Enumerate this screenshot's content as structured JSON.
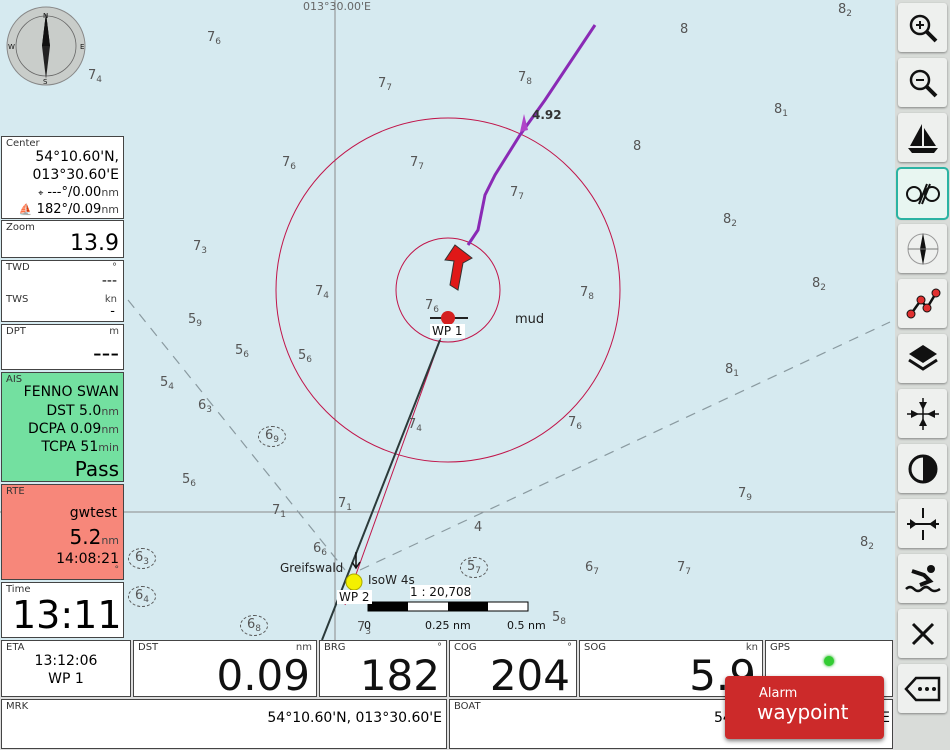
{
  "chart": {
    "top_coordinate": "013°30.00'E",
    "depths": [
      {
        "d": "7",
        "s": "6"
      },
      {
        "d": "7",
        "s": "4"
      },
      {
        "d": "7",
        "s": "7"
      },
      {
        "d": "7",
        "s": "8"
      },
      {
        "d": "8",
        "s": ""
      },
      {
        "d": "8",
        "s": "2"
      },
      {
        "d": "8",
        "s": "1"
      },
      {
        "d": "8",
        "s": ""
      },
      {
        "d": "7",
        "s": "6"
      },
      {
        "d": "7",
        "s": "7"
      },
      {
        "d": "7",
        "s": "7"
      },
      {
        "d": "8",
        "s": "2"
      },
      {
        "d": "7",
        "s": "3"
      },
      {
        "d": "7",
        "s": "4"
      },
      {
        "d": "7",
        "s": "6"
      },
      {
        "d": "7",
        "s": "8"
      },
      {
        "d": "8",
        "s": "2"
      },
      {
        "d": "5",
        "s": "9"
      },
      {
        "d": "5",
        "s": "6"
      },
      {
        "d": "5",
        "s": "6"
      },
      {
        "d": "5",
        "s": "4"
      },
      {
        "d": "6",
        "s": "3"
      },
      {
        "d": "8",
        "s": "1"
      },
      {
        "d": "7",
        "s": "4"
      },
      {
        "d": "7",
        "s": "6"
      },
      {
        "d": "5",
        "s": "6"
      },
      {
        "d": "7",
        "s": "1"
      },
      {
        "d": "7",
        "s": "1"
      },
      {
        "d": "7",
        "s": "9"
      },
      {
        "d": "6",
        "s": "6"
      },
      {
        "d": "6",
        "s": "7"
      },
      {
        "d": "7",
        "s": "7"
      },
      {
        "d": "8",
        "s": "2"
      },
      {
        "d": "7",
        "s": "3"
      },
      {
        "d": "5",
        "s": "8"
      },
      {
        "d": "4",
        "s": ""
      }
    ],
    "rocks": [
      {
        "d": "6",
        "s": "9"
      },
      {
        "d": "6",
        "s": "3"
      },
      {
        "d": "6",
        "s": "4"
      },
      {
        "d": "6",
        "s": "8"
      },
      {
        "d": "5",
        "s": "7"
      }
    ],
    "speed_label": "4.92",
    "mud_label": "mud",
    "wp1_label": "WP 1",
    "wp2_label": "WP 2",
    "greifswald_label": "Greifswald",
    "light_label": "IsoW 4s",
    "scale": {
      "ratio": "1 : 20,708",
      "t0": "0",
      "t1": "0.25 nm",
      "t2": "0.5 nm"
    }
  },
  "left": {
    "center": {
      "label": "Center",
      "lat": "54°10.60'N,",
      "lon": "013°30.60'E",
      "wp": "---°/0.00",
      "wp_unit": "nm",
      "boat": "182°/0.09",
      "boat_unit": "nm"
    },
    "zoom": {
      "label": "Zoom",
      "value": "13.9"
    },
    "wind": {
      "twd_label": "TWD",
      "twd_unit": "°",
      "twd_value": "---",
      "tws_label": "TWS",
      "tws_unit": "kn",
      "tws_value": "-"
    },
    "dpt": {
      "label": "DPT",
      "unit": "m",
      "value": "---"
    },
    "ais": {
      "label": "AIS",
      "name": "FENNO SWAN",
      "dst_label": "DST",
      "dst": "5.0",
      "dst_unit": "nm",
      "dcpa_label": "DCPA",
      "dcpa": "0.09",
      "dcpa_unit": "nm",
      "tcpa_label": "TCPA",
      "tcpa": "51",
      "tcpa_unit": "min",
      "status": "Pass"
    },
    "rte": {
      "label": "RTE",
      "name": "gwtest",
      "dist": "5.2",
      "dist_unit": "nm",
      "eta": "14:08:21",
      "deg": "°"
    },
    "time": {
      "label": "Time",
      "value": "13:11"
    }
  },
  "bottom": {
    "eta": {
      "label": "ETA",
      "time": "13:12:06",
      "wp": "WP 1"
    },
    "dst": {
      "label": "DST",
      "unit": "nm",
      "value": "0.09"
    },
    "brg": {
      "label": "BRG",
      "unit": "°",
      "value": "182"
    },
    "cog": {
      "label": "COG",
      "unit": "°",
      "value": "204"
    },
    "sog": {
      "label": "SOG",
      "unit": "kn",
      "value": "5.9"
    },
    "gps": {
      "label": "GPS"
    },
    "mrk": {
      "label": "MRK",
      "value": "54°10.60'N, 013°30.60'E"
    },
    "boat": {
      "label": "BOAT",
      "value": "54°10.5",
      "value_end": "E"
    }
  },
  "alarm": {
    "title": "Alarm",
    "text": "waypoint"
  },
  "toolbar": [
    "zoom-in-icon",
    "zoom-out-icon",
    "boat-icon",
    "lock-icon",
    "compass-icon",
    "route-icon",
    "layers-icon",
    "center-icon",
    "contrast-icon",
    "anchor-icon",
    "mob-icon",
    "close-icon",
    "keyboard-back-icon"
  ],
  "colors": {
    "chart": "#d6eaf0",
    "ais": "#73e0a0",
    "rte": "#f7877a",
    "alarm": "#cc2a2a",
    "track": "#8a2ab5",
    "gps": "#3c3"
  }
}
